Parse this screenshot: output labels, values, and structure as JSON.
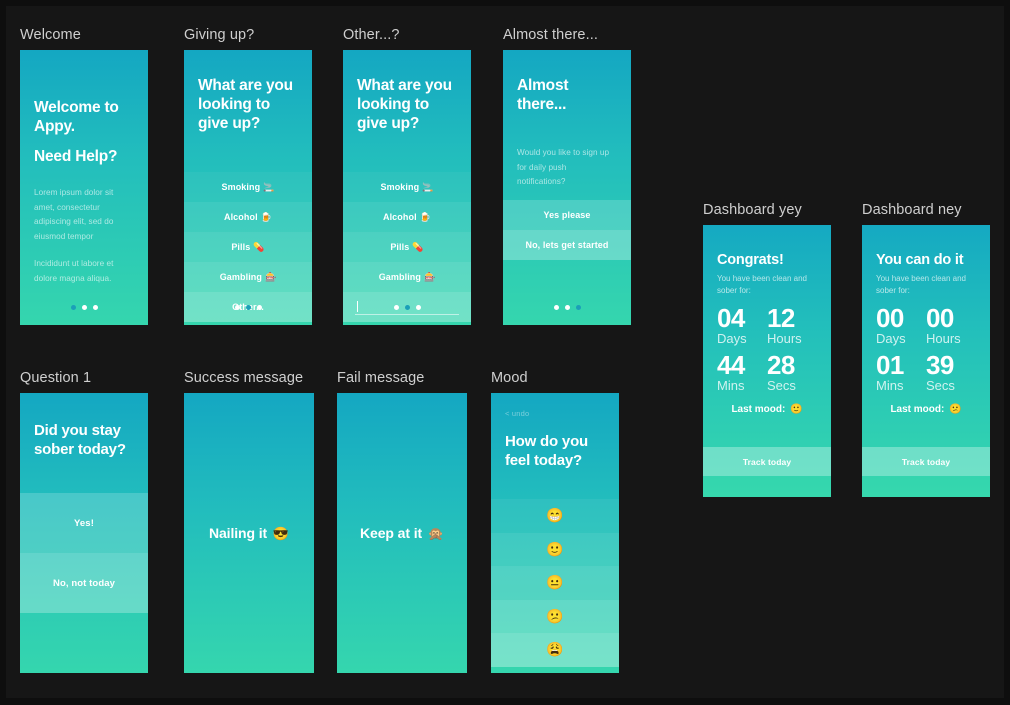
{
  "canvas": {
    "background": "#161616",
    "outer_background": "#0e0e0e"
  },
  "theme": {
    "gradient_top": "#14a7c2",
    "gradient_mid": "#22bdbd",
    "gradient_bottom": "#35d6ae",
    "label_color": "#cfcfcf",
    "active_dot": "#1b9fb8"
  },
  "screens": {
    "welcome": {
      "label": "Welcome",
      "title_line1": "Welcome to",
      "title_line2": "Appy.",
      "title_line3": "Need Help?",
      "paragraph1": "Lorem ipsum dolor sit amet, consectetur adipiscing elit, sed do eiusmod tempor",
      "paragraph2": "Incididunt ut labore et dolore magna aliqua.",
      "pager": {
        "count": 3,
        "active_index": 0
      }
    },
    "giving_up": {
      "label": "Giving up?",
      "title": "What are you looking to give up?",
      "options": [
        {
          "label": "Smoking",
          "emoji": "🚬"
        },
        {
          "label": "Alcohol",
          "emoji": "🍺"
        },
        {
          "label": "Pills",
          "emoji": "💊"
        },
        {
          "label": "Gambling",
          "emoji": "🎰"
        },
        {
          "label": "Other...",
          "emoji": ""
        }
      ],
      "pager": {
        "count": 3,
        "active_index": 1
      }
    },
    "other": {
      "label": "Other...?",
      "title": "What are you looking to give up?",
      "options": [
        {
          "label": "Smoking",
          "emoji": "🚬"
        },
        {
          "label": "Alcohol",
          "emoji": "🍺"
        },
        {
          "label": "Pills",
          "emoji": "💊"
        },
        {
          "label": "Gambling",
          "emoji": "🎰"
        }
      ],
      "input_value": "",
      "input_placeholder": "",
      "pager": {
        "count": 3,
        "active_index": 1
      }
    },
    "almost_there": {
      "label": "Almost there...",
      "title_line1": "Almost",
      "title_line2": "there...",
      "question": "Would you like to sign up for daily push notifications?",
      "yes_label": "Yes please",
      "no_label": "No, lets get started",
      "pager": {
        "count": 3,
        "active_index": 2
      }
    },
    "question1": {
      "label": "Question 1",
      "title_line1": "Did you stay",
      "title_line2": "sober today?",
      "yes_label": "Yes!",
      "no_label": "No, not today"
    },
    "success": {
      "label": "Success message",
      "message": "Nailing it",
      "emoji": "😎"
    },
    "fail": {
      "label": "Fail message",
      "message": "Keep at it",
      "emoji": "🙊"
    },
    "mood": {
      "label": "Mood",
      "undo_label": "< undo",
      "title_line1": "How do you",
      "title_line2": "feel today?",
      "moods": [
        {
          "name": "grinning-face",
          "emoji": "😁"
        },
        {
          "name": "slightly-smiling-face",
          "emoji": "🙂"
        },
        {
          "name": "neutral-face",
          "emoji": "😐"
        },
        {
          "name": "frowning-face",
          "emoji": "😕"
        },
        {
          "name": "weary-face",
          "emoji": "😩"
        }
      ]
    },
    "dashboard_yey": {
      "label": "Dashboard yey",
      "title": "Congrats!",
      "subtitle": "You have been clean and sober for:",
      "counters": [
        {
          "value": "04",
          "unit": "Days"
        },
        {
          "value": "12",
          "unit": "Hours"
        },
        {
          "value": "44",
          "unit": "Mins"
        },
        {
          "value": "28",
          "unit": "Secs"
        }
      ],
      "last_mood_label": "Last mood:",
      "last_mood_emoji": "🙂",
      "track_label": "Track today"
    },
    "dashboard_ney": {
      "label": "Dashboard ney",
      "title": "You can do it",
      "subtitle": "You have been clean and sober for:",
      "counters": [
        {
          "value": "00",
          "unit": "Days"
        },
        {
          "value": "00",
          "unit": "Hours"
        },
        {
          "value": "01",
          "unit": "Mins"
        },
        {
          "value": "39",
          "unit": "Secs"
        }
      ],
      "last_mood_label": "Last mood:",
      "last_mood_emoji": "😕",
      "track_label": "Track today"
    }
  }
}
